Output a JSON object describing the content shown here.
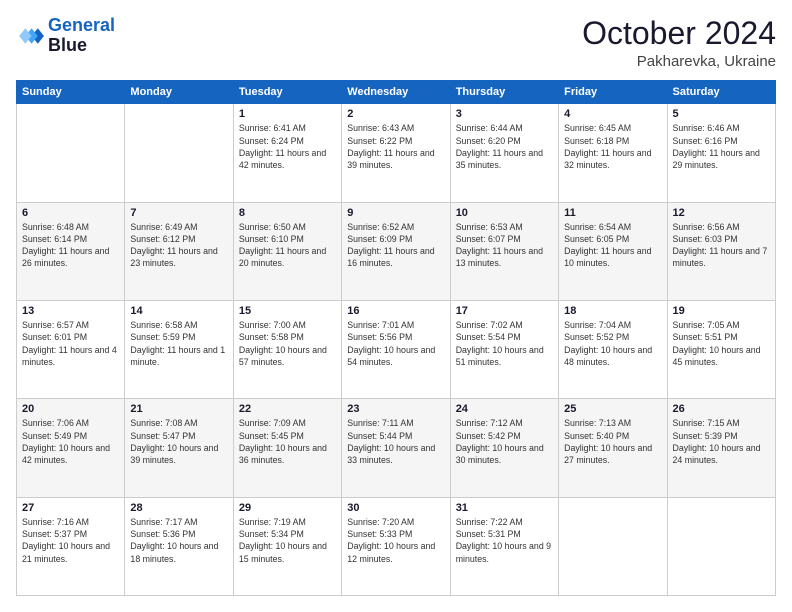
{
  "header": {
    "logo_line1": "General",
    "logo_line2": "Blue",
    "month": "October 2024",
    "location": "Pakharevka, Ukraine"
  },
  "weekdays": [
    "Sunday",
    "Monday",
    "Tuesday",
    "Wednesday",
    "Thursday",
    "Friday",
    "Saturday"
  ],
  "weeks": [
    [
      {
        "day": "",
        "info": ""
      },
      {
        "day": "",
        "info": ""
      },
      {
        "day": "1",
        "info": "Sunrise: 6:41 AM\nSunset: 6:24 PM\nDaylight: 11 hours and 42 minutes."
      },
      {
        "day": "2",
        "info": "Sunrise: 6:43 AM\nSunset: 6:22 PM\nDaylight: 11 hours and 39 minutes."
      },
      {
        "day": "3",
        "info": "Sunrise: 6:44 AM\nSunset: 6:20 PM\nDaylight: 11 hours and 35 minutes."
      },
      {
        "day": "4",
        "info": "Sunrise: 6:45 AM\nSunset: 6:18 PM\nDaylight: 11 hours and 32 minutes."
      },
      {
        "day": "5",
        "info": "Sunrise: 6:46 AM\nSunset: 6:16 PM\nDaylight: 11 hours and 29 minutes."
      }
    ],
    [
      {
        "day": "6",
        "info": "Sunrise: 6:48 AM\nSunset: 6:14 PM\nDaylight: 11 hours and 26 minutes."
      },
      {
        "day": "7",
        "info": "Sunrise: 6:49 AM\nSunset: 6:12 PM\nDaylight: 11 hours and 23 minutes."
      },
      {
        "day": "8",
        "info": "Sunrise: 6:50 AM\nSunset: 6:10 PM\nDaylight: 11 hours and 20 minutes."
      },
      {
        "day": "9",
        "info": "Sunrise: 6:52 AM\nSunset: 6:09 PM\nDaylight: 11 hours and 16 minutes."
      },
      {
        "day": "10",
        "info": "Sunrise: 6:53 AM\nSunset: 6:07 PM\nDaylight: 11 hours and 13 minutes."
      },
      {
        "day": "11",
        "info": "Sunrise: 6:54 AM\nSunset: 6:05 PM\nDaylight: 11 hours and 10 minutes."
      },
      {
        "day": "12",
        "info": "Sunrise: 6:56 AM\nSunset: 6:03 PM\nDaylight: 11 hours and 7 minutes."
      }
    ],
    [
      {
        "day": "13",
        "info": "Sunrise: 6:57 AM\nSunset: 6:01 PM\nDaylight: 11 hours and 4 minutes."
      },
      {
        "day": "14",
        "info": "Sunrise: 6:58 AM\nSunset: 5:59 PM\nDaylight: 11 hours and 1 minute."
      },
      {
        "day": "15",
        "info": "Sunrise: 7:00 AM\nSunset: 5:58 PM\nDaylight: 10 hours and 57 minutes."
      },
      {
        "day": "16",
        "info": "Sunrise: 7:01 AM\nSunset: 5:56 PM\nDaylight: 10 hours and 54 minutes."
      },
      {
        "day": "17",
        "info": "Sunrise: 7:02 AM\nSunset: 5:54 PM\nDaylight: 10 hours and 51 minutes."
      },
      {
        "day": "18",
        "info": "Sunrise: 7:04 AM\nSunset: 5:52 PM\nDaylight: 10 hours and 48 minutes."
      },
      {
        "day": "19",
        "info": "Sunrise: 7:05 AM\nSunset: 5:51 PM\nDaylight: 10 hours and 45 minutes."
      }
    ],
    [
      {
        "day": "20",
        "info": "Sunrise: 7:06 AM\nSunset: 5:49 PM\nDaylight: 10 hours and 42 minutes."
      },
      {
        "day": "21",
        "info": "Sunrise: 7:08 AM\nSunset: 5:47 PM\nDaylight: 10 hours and 39 minutes."
      },
      {
        "day": "22",
        "info": "Sunrise: 7:09 AM\nSunset: 5:45 PM\nDaylight: 10 hours and 36 minutes."
      },
      {
        "day": "23",
        "info": "Sunrise: 7:11 AM\nSunset: 5:44 PM\nDaylight: 10 hours and 33 minutes."
      },
      {
        "day": "24",
        "info": "Sunrise: 7:12 AM\nSunset: 5:42 PM\nDaylight: 10 hours and 30 minutes."
      },
      {
        "day": "25",
        "info": "Sunrise: 7:13 AM\nSunset: 5:40 PM\nDaylight: 10 hours and 27 minutes."
      },
      {
        "day": "26",
        "info": "Sunrise: 7:15 AM\nSunset: 5:39 PM\nDaylight: 10 hours and 24 minutes."
      }
    ],
    [
      {
        "day": "27",
        "info": "Sunrise: 7:16 AM\nSunset: 5:37 PM\nDaylight: 10 hours and 21 minutes."
      },
      {
        "day": "28",
        "info": "Sunrise: 7:17 AM\nSunset: 5:36 PM\nDaylight: 10 hours and 18 minutes."
      },
      {
        "day": "29",
        "info": "Sunrise: 7:19 AM\nSunset: 5:34 PM\nDaylight: 10 hours and 15 minutes."
      },
      {
        "day": "30",
        "info": "Sunrise: 7:20 AM\nSunset: 5:33 PM\nDaylight: 10 hours and 12 minutes."
      },
      {
        "day": "31",
        "info": "Sunrise: 7:22 AM\nSunset: 5:31 PM\nDaylight: 10 hours and 9 minutes."
      },
      {
        "day": "",
        "info": ""
      },
      {
        "day": "",
        "info": ""
      }
    ]
  ]
}
